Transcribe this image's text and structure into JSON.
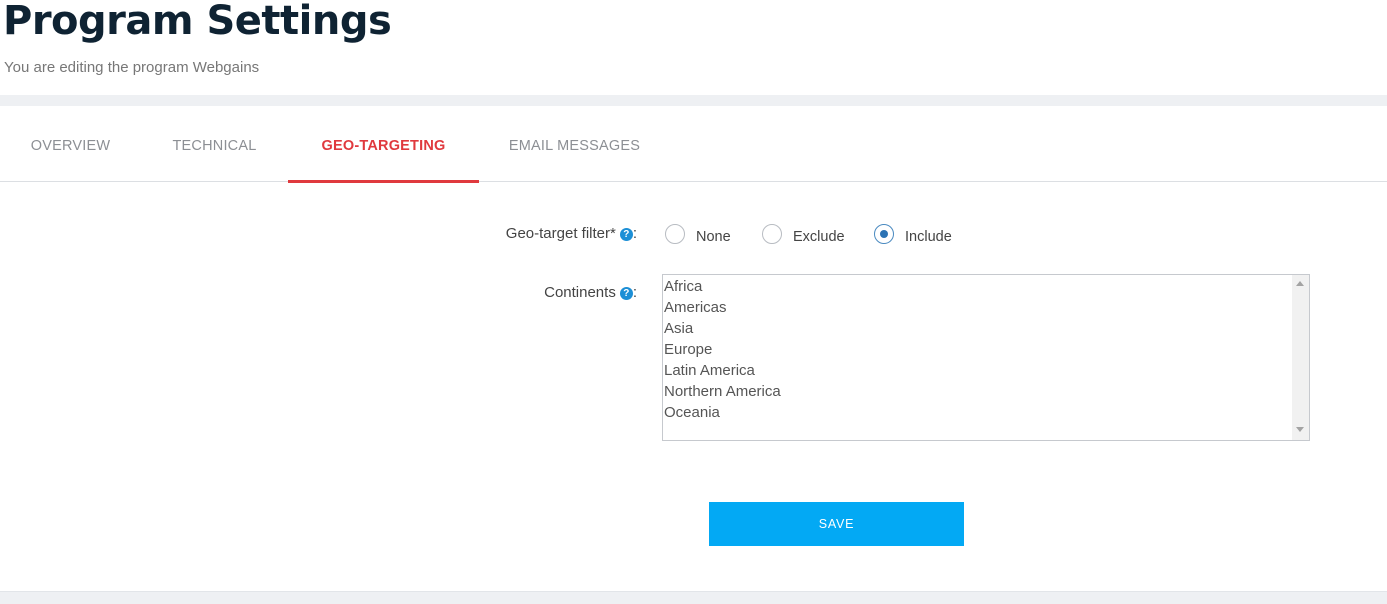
{
  "header": {
    "title": "Program Settings",
    "subtitle": "You are editing the program Webgains"
  },
  "tabs": [
    {
      "label": "OVERVIEW",
      "active": false
    },
    {
      "label": "TECHNICAL",
      "active": false
    },
    {
      "label": "GEO-TARGETING",
      "active": true
    },
    {
      "label": "EMAIL MESSAGES",
      "active": false
    }
  ],
  "form": {
    "geo_filter": {
      "label": "Geo-target filter*",
      "suffix": ":",
      "help_icon": "question-circle-icon",
      "options": [
        "None",
        "Exclude",
        "Include"
      ],
      "selected": "Include"
    },
    "continents": {
      "label": "Continents",
      "suffix": ":",
      "help_icon": "question-circle-icon",
      "items": [
        "Africa",
        "Americas",
        "Asia",
        "Europe",
        "Latin America",
        "Northern America",
        "Oceania"
      ]
    },
    "save_label": "SAVE"
  },
  "colors": {
    "accent_active_tab": "#e0393e",
    "save_button": "#03a9f4",
    "help_icon": "#1c8fd6",
    "title": "#0f2333"
  }
}
